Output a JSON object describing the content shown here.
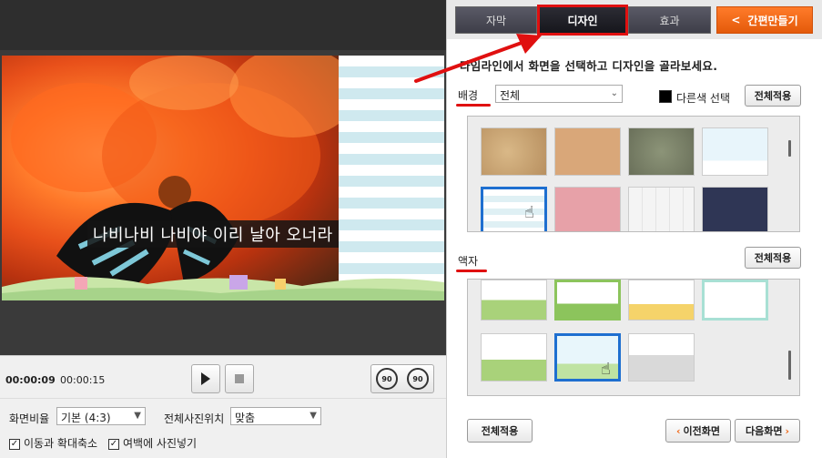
{
  "caption": "나비나비 나비야 이리 날아 오너라",
  "playback": {
    "current_time": "00:00:09",
    "total_time": "00:00:15",
    "rotate_left_label": "90",
    "rotate_right_label": "90"
  },
  "settings": {
    "ratio_label": "화면비율",
    "ratio_value": "기본 (4:3)",
    "position_label": "전체사진위치",
    "position_value": "맞춤",
    "check_motion_label": "이동과 확대축소",
    "check_margin_label": "여백에 사진넣기"
  },
  "tabs": {
    "subtitle": "자막",
    "design": "디자인",
    "effect": "효과",
    "quick_make": "간편만들기"
  },
  "instruction": "타임라인에서 화면을 선택하고 디자인을 골라보세요.",
  "background": {
    "label": "배경",
    "filter_value": "전체",
    "other_color_label": "다른색 선택",
    "apply_all": "전체적용"
  },
  "frame": {
    "label": "액자",
    "apply_all": "전체적용"
  },
  "footer": {
    "apply_all": "전체적용",
    "prev": "이전화면",
    "next": "다음화면"
  },
  "colors": {
    "accent_orange": "#f06a1a",
    "highlight_red": "#e01010",
    "selected_blue": "#1e6fd0"
  }
}
